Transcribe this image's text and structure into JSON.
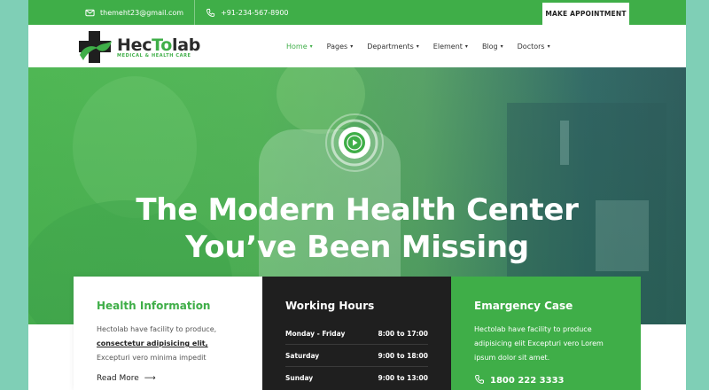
{
  "topbar": {
    "email": "themeht23@gmail.com",
    "phone": "+91-234-567-8900",
    "appointment_button": "MAKE APPOINTMENT"
  },
  "logo": {
    "name_part1": "Hec",
    "name_part2": "To",
    "name_part3": "lab",
    "tagline": "MEDICAL & HEALTH CARE"
  },
  "nav": {
    "items": [
      {
        "label": "Home"
      },
      {
        "label": "Pages"
      },
      {
        "label": "Departments"
      },
      {
        "label": "Element"
      },
      {
        "label": "Blog"
      },
      {
        "label": "Doctors"
      }
    ],
    "active": "Home"
  },
  "hero": {
    "title_line1": "The Modern Health Center",
    "title_line2": "You’ve Been Missing"
  },
  "cards": {
    "health": {
      "title": "Health Information",
      "text_before": "Hectolab have facility to produce,",
      "text_link": "consectetur adipisicing elit,",
      "text_after": "Excepturi vero minima impedit",
      "readmore": "Read More"
    },
    "hours": {
      "title": "Working Hours",
      "rows": [
        {
          "day": "Monday - Friday",
          "time": "8:00 to 17:00"
        },
        {
          "day": "Saturday",
          "time": "9:00 to 18:00"
        },
        {
          "day": "Sunday",
          "time": "9:00 to 13:00"
        }
      ]
    },
    "emergency": {
      "title": "Emargency Case",
      "text": "Hectolab have facility to produce adipisicing elit Excepturi vero Lorem ipsum dolor sit amet.",
      "phone": "1800 222 3333"
    }
  },
  "colors": {
    "brand_green": "#3fae48",
    "dark": "#1f1f1f",
    "background": "#7fcfb6"
  }
}
